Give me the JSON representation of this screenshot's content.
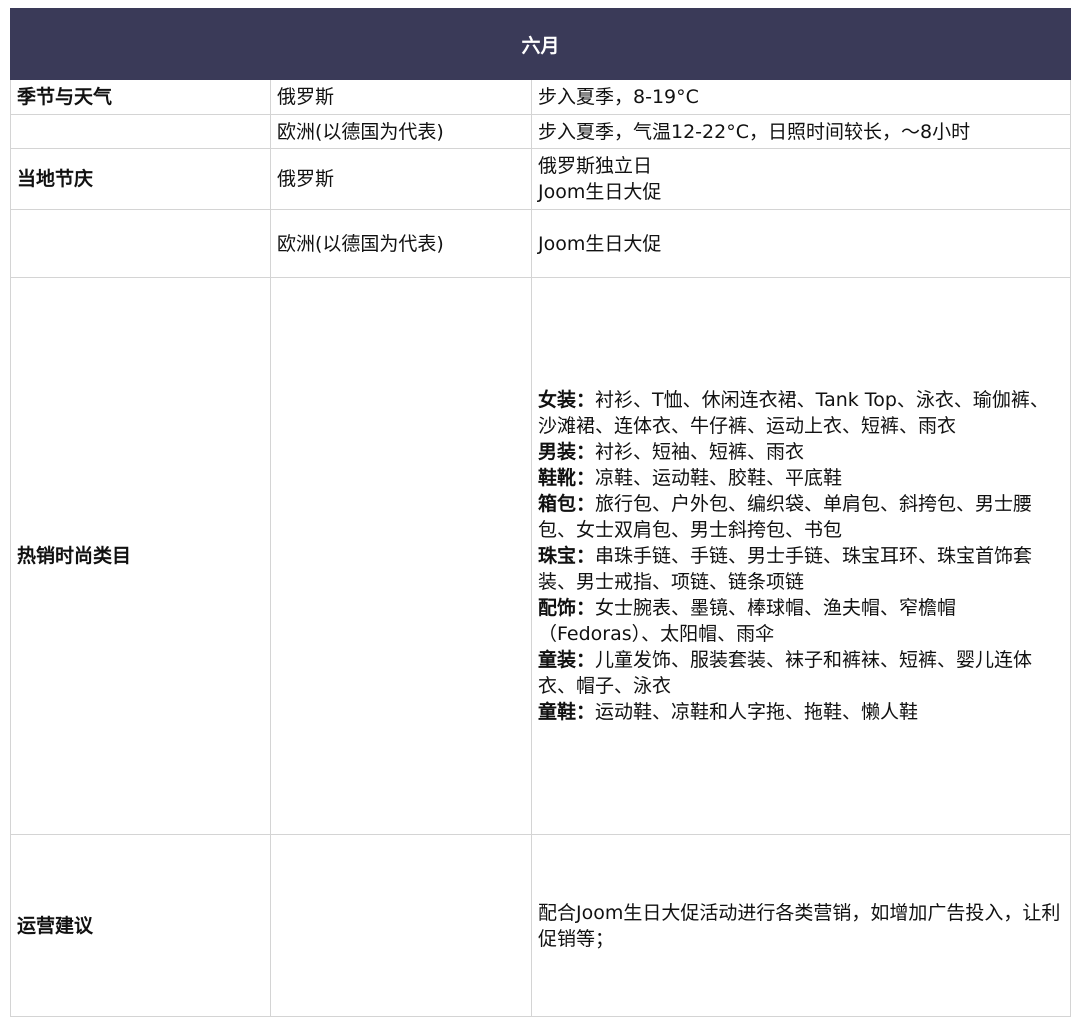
{
  "header": {
    "month": "六月"
  },
  "rows": {
    "weather_ru": {
      "label": "季节与天气",
      "region": "俄罗斯",
      "content": "步入夏季，8-19°C"
    },
    "weather_eu": {
      "label": "",
      "region": "欧洲(以德国为代表)",
      "content": "步入夏季，气温12-22°C，日照时间较长，～8小时"
    },
    "festival_ru": {
      "label": "当地节庆",
      "region": "俄罗斯",
      "lines": [
        "俄罗斯独立日",
        "Joom生日大促"
      ]
    },
    "festival_eu": {
      "label": "",
      "region": "欧洲(以德国为代表)",
      "content": "Joom生日大促"
    },
    "hot_categories": {
      "label": "热销时尚类目",
      "region": "",
      "items": [
        {
          "name": "女装：",
          "text": "衬衫、T恤、休闲连衣裙、Tank Top、泳衣、瑜伽裤、沙滩裙、连体衣、牛仔裤、运动上衣、短裤、雨衣"
        },
        {
          "name": "男装：",
          "text": "衬衫、短袖、短裤、雨衣"
        },
        {
          "name": "鞋靴：",
          "text": "凉鞋、运动鞋、胶鞋、平底鞋"
        },
        {
          "name": "箱包：",
          "text": "旅行包、户外包、编织袋、单肩包、斜挎包、男士腰包、女士双肩包、男士斜挎包、书包"
        },
        {
          "name": "珠宝：",
          "text": "串珠手链、手链、男士手链、珠宝耳环、珠宝首饰套装、男士戒指、项链、链条项链"
        },
        {
          "name": "配饰：",
          "text": "女士腕表、墨镜、棒球帽、渔夫帽、窄檐帽（Fedoras）、太阳帽、雨伞"
        },
        {
          "name": "童装：",
          "text": "儿童发饰、服装套装、袜子和裤袜、短裤、婴儿连体衣、帽子、泳衣"
        },
        {
          "name": "童鞋：",
          "text": "运动鞋、凉鞋和人字拖、拖鞋、懒人鞋"
        }
      ]
    },
    "operations": {
      "label": "运营建议",
      "region": "",
      "content": "配合Joom生日大促活动进行各类营销，如增加广告投入，让利促销等；"
    }
  }
}
